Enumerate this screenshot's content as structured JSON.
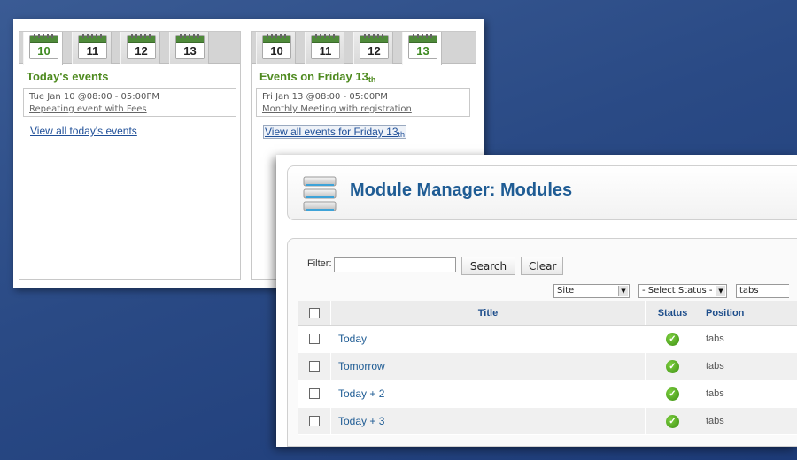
{
  "events_left": {
    "tabs": [
      "10",
      "11",
      "12",
      "13"
    ],
    "active_tab": 0,
    "heading": "Today's events",
    "event_time": "Tue Jan 10 @08:00 - 05:00PM",
    "event_link": "Repeating event with Fees",
    "view_all": "View all today's events"
  },
  "events_right": {
    "tabs": [
      "10",
      "11",
      "12",
      "13"
    ],
    "active_tab": 3,
    "heading": "Events on Friday 13",
    "heading_suffix": "th",
    "event_time": "Fri Jan 13 @08:00 - 05:00PM",
    "event_link": "Monthly Meeting with registration",
    "view_all": "View all events for Friday 13",
    "view_all_suffix": "th"
  },
  "module_manager": {
    "title": "Module Manager: Modules",
    "filter_label": "Filter:",
    "filter_value": "",
    "search_label": "Search",
    "clear_label": "Clear",
    "site_select": "Site",
    "status_select": "- Select Status -",
    "position_select": "tabs",
    "columns": {
      "title": "Title",
      "status": "Status",
      "position": "Position"
    },
    "rows": [
      {
        "title": "Today",
        "position": "tabs"
      },
      {
        "title": "Tomorrow",
        "position": "tabs"
      },
      {
        "title": "Today + 2",
        "position": "tabs"
      },
      {
        "title": "Today + 3",
        "position": "tabs"
      }
    ]
  }
}
